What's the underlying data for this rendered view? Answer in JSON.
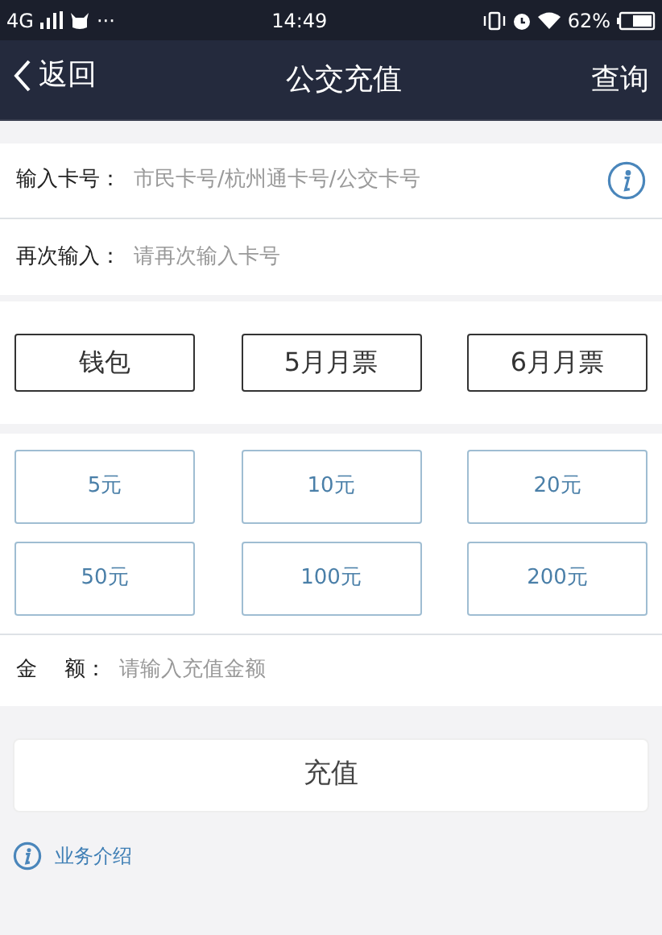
{
  "status_bar": {
    "network": "4G",
    "more": "···",
    "time": "14:49",
    "battery": "62%"
  },
  "nav": {
    "back": "返回",
    "title": "公交充值",
    "action": "查询"
  },
  "fields": [
    {
      "label": "输入卡号：",
      "placeholder": "市民卡号/杭州通卡号/公交卡号",
      "info": true
    },
    {
      "label": "再次输入：",
      "placeholder": "请再次输入卡号",
      "info": false
    }
  ],
  "card_types": [
    "钱包",
    "5月月票",
    "6月月票"
  ],
  "amounts": [
    "5元",
    "10元",
    "20元",
    "50元",
    "100元",
    "200元"
  ],
  "amount_field": {
    "label_parts": [
      "金",
      "额："
    ],
    "placeholder": "请输入充值金额"
  },
  "submit": "充值",
  "info_link": "业务介绍"
}
